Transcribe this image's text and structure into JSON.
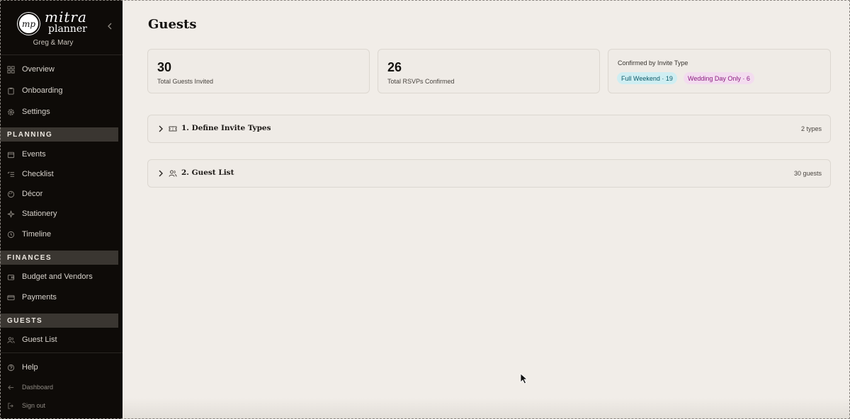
{
  "brand": {
    "logo_monogram": "mp",
    "logo_word1": "mitra",
    "logo_word2": "planner",
    "couple": "Greg & Mary",
    "collapse_icon": "chevron-left-icon"
  },
  "sidebar": {
    "top_items": [
      {
        "label": "Overview",
        "icon": "grid-icon"
      },
      {
        "label": "Onboarding",
        "icon": "clipboard-icon"
      },
      {
        "label": "Settings",
        "icon": "gear-icon"
      }
    ],
    "sections": [
      {
        "title": "PLANNING",
        "items": [
          {
            "label": "Events",
            "icon": "calendar-icon"
          },
          {
            "label": "Checklist",
            "icon": "checklist-icon"
          },
          {
            "label": "Décor",
            "icon": "palette-icon"
          },
          {
            "label": "Stationery",
            "icon": "sparkle-icon"
          },
          {
            "label": "Timeline",
            "icon": "clock-icon"
          }
        ]
      },
      {
        "title": "FINANCES",
        "items": [
          {
            "label": "Budget and Vendors",
            "icon": "wallet-icon"
          },
          {
            "label": "Payments",
            "icon": "credit-card-icon"
          }
        ]
      },
      {
        "title": "GUESTS",
        "items": [
          {
            "label": "Guest List",
            "icon": "users-icon"
          }
        ]
      }
    ],
    "bottom_items": [
      {
        "label": "Help",
        "icon": "help-circle-icon"
      },
      {
        "label": "Dashboard",
        "icon": "arrow-left-icon"
      },
      {
        "label": "Sign out",
        "icon": "sign-out-icon"
      }
    ]
  },
  "main": {
    "title": "Guests",
    "stats": [
      {
        "value": "30",
        "caption": "Total Guests Invited"
      },
      {
        "value": "26",
        "caption": "Total RSVPs Confirmed"
      }
    ],
    "invite_type_card": {
      "heading": "Confirmed by Invite Type",
      "pills": [
        {
          "label": "Full Weekend · 19",
          "color": "#cfeef2"
        },
        {
          "label": "Wedding Day Only · 6",
          "color": "#f3dcef"
        }
      ]
    },
    "panels": [
      {
        "title": "1. Define Invite Types",
        "meta": "2 types",
        "icon": "ticket-icon"
      },
      {
        "title": "2. Guest List",
        "meta": "30 guests",
        "icon": "users-icon"
      }
    ]
  },
  "colors": {
    "sidebar_bg": "#0e0b08",
    "main_bg": "#f1ede8",
    "section_head_bg": "#3a3631"
  }
}
